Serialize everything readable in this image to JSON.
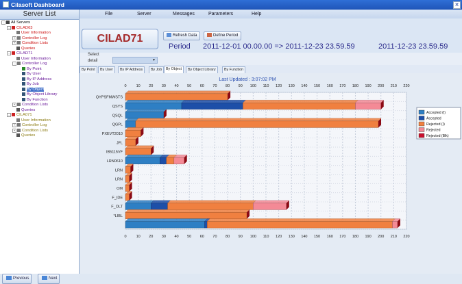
{
  "window": {
    "title": "Cilasoft Dashboard"
  },
  "sidebar": {
    "header": "Server List",
    "tree": [
      {
        "label": "All Servers",
        "level": 0,
        "cls": "blk",
        "toggle": "-",
        "icon": "#444"
      },
      {
        "label": "CILAD63",
        "level": 1,
        "cls": "red",
        "toggle": "-",
        "icon": "#c22"
      },
      {
        "label": "User Information",
        "level": 2,
        "cls": "red",
        "toggle": "",
        "icon": "#777"
      },
      {
        "label": "Controller Log",
        "level": 2,
        "cls": "red",
        "toggle": "+",
        "icon": "#777"
      },
      {
        "label": "Condition Lists",
        "level": 2,
        "cls": "red",
        "toggle": "+",
        "icon": "#777"
      },
      {
        "label": "Queries",
        "level": 2,
        "cls": "red",
        "toggle": "",
        "icon": "#555"
      },
      {
        "label": "CILAD71",
        "level": 1,
        "cls": "purple",
        "toggle": "-",
        "icon": "#c22"
      },
      {
        "label": "User Information",
        "level": 2,
        "cls": "purple",
        "toggle": "",
        "icon": "#777"
      },
      {
        "label": "Controller Log",
        "level": 2,
        "cls": "purple",
        "toggle": "-",
        "icon": "#777"
      },
      {
        "label": "By Point",
        "level": 3,
        "cls": "purple",
        "toggle": "",
        "icon": "#2a8a2a"
      },
      {
        "label": "By User",
        "level": 3,
        "cls": "purple",
        "toggle": "",
        "icon": "#357"
      },
      {
        "label": "By IP Address",
        "level": 3,
        "cls": "purple",
        "toggle": "",
        "icon": "#357"
      },
      {
        "label": "By Job",
        "level": 3,
        "cls": "purple",
        "toggle": "",
        "icon": "#357"
      },
      {
        "label": "By Object",
        "level": 3,
        "cls": "purple",
        "toggle": "",
        "icon": "#357",
        "selected": true
      },
      {
        "label": "By Object Library",
        "level": 3,
        "cls": "purple",
        "toggle": "",
        "icon": "#357"
      },
      {
        "label": "By Function",
        "level": 3,
        "cls": "purple",
        "toggle": "",
        "icon": "#357"
      },
      {
        "label": "Condition Lists",
        "level": 2,
        "cls": "purple",
        "toggle": "+",
        "icon": "#777"
      },
      {
        "label": "Queries",
        "level": 2,
        "cls": "purple",
        "toggle": "",
        "icon": "#555"
      },
      {
        "label": "CILA071",
        "level": 1,
        "cls": "olive",
        "toggle": "-",
        "icon": "#c22"
      },
      {
        "label": "User Information",
        "level": 2,
        "cls": "olive",
        "toggle": "",
        "icon": "#777"
      },
      {
        "label": "Controller Log",
        "level": 2,
        "cls": "olive",
        "toggle": "+",
        "icon": "#777"
      },
      {
        "label": "Condition Lists",
        "level": 2,
        "cls": "olive",
        "toggle": "+",
        "icon": "#777"
      },
      {
        "label": "Queries",
        "level": 2,
        "cls": "olive",
        "toggle": "",
        "icon": "#555"
      }
    ],
    "prev_label": "Previous",
    "next_label": "Next"
  },
  "menu": {
    "file": "File",
    "server": "Server",
    "messages": "Messages",
    "parameters": "Parameters",
    "help": "Help"
  },
  "toolbar": {
    "server_name": "CILAD71",
    "refresh_label": "Refresh Data",
    "define_period_label": "Define Period",
    "period_label": "Period",
    "period_range": "2011-12-01  00.00.00  => 2011-12-23  23.59.59",
    "period_end": "2011-12-23  23.59.59"
  },
  "select": {
    "label1": "Select",
    "label2": "detail",
    "value": ""
  },
  "tabs": [
    "By Point",
    "By User",
    "By IP Address",
    "By Job",
    "By Object",
    "By Object Library",
    "By Function"
  ],
  "active_tab": 4,
  "chart_data": {
    "type": "bar",
    "orientation": "horizontal",
    "stacked": true,
    "last_updated": "Last Updated :  3:07:02 PM",
    "xlim": [
      0,
      220
    ],
    "xticks": [
      0,
      10,
      20,
      30,
      40,
      50,
      60,
      70,
      80,
      90,
      100,
      110,
      120,
      130,
      140,
      150,
      160,
      170,
      180,
      190,
      200,
      210,
      220
    ],
    "grid": true,
    "legend_position": "right",
    "categories": [
      "QYPSFMWSTS",
      "QSYS",
      "QSQL",
      "QGPL",
      "PXEVT2010",
      "JFL",
      "IB5115VF",
      "LRN0610",
      "LRN",
      "LRN",
      "OM",
      "F_IDE",
      "F_OLT",
      "*LIBL",
      ""
    ],
    "series": [
      {
        "name": "Accepted (I)",
        "color": "#2e7fc4",
        "values": [
          0,
          44,
          30,
          8,
          0,
          0,
          0,
          27,
          0,
          0,
          0,
          0,
          20,
          0,
          62
        ]
      },
      {
        "name": "Accepted",
        "color": "#1d4fa8",
        "values": [
          0,
          48,
          0,
          0,
          0,
          0,
          0,
          5,
          0,
          0,
          0,
          0,
          13,
          0,
          2
        ]
      },
      {
        "name": "Rejected (I)",
        "color": "#f08040",
        "values": [
          80,
          88,
          0,
          190,
          12,
          8,
          20,
          6,
          4,
          3,
          3,
          3,
          67,
          95,
          145
        ]
      },
      {
        "name": "Rejected",
        "color": "#f48a96",
        "values": [
          0,
          20,
          0,
          0,
          0,
          0,
          0,
          8,
          0,
          0,
          0,
          0,
          26,
          0,
          4
        ]
      },
      {
        "name": "Rejected (Blk)",
        "color": "#c8102e",
        "values": [
          0,
          0,
          0,
          0,
          0,
          0,
          0,
          0,
          0,
          0,
          0,
          0,
          0,
          0,
          0
        ]
      }
    ]
  }
}
